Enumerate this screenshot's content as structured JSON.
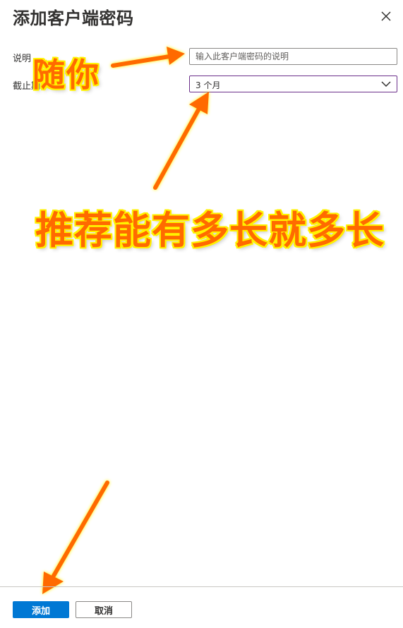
{
  "dialog": {
    "title": "添加客户端密码",
    "close_icon": "close-icon"
  },
  "form": {
    "description_label": "说明",
    "description_placeholder": "输入此客户端密码的说明",
    "description_value": "",
    "expiry_label": "截止期",
    "expiry_value": "3 个月",
    "expiry_icon": "chevron-down-icon"
  },
  "annotations": {
    "whatever": "随你",
    "recommend": "推荐能有多长就多长",
    "color": "#ff6a00",
    "outline_color": "#fff200"
  },
  "footer": {
    "add_label": "添加",
    "cancel_label": "取消"
  },
  "colors": {
    "primary": "#0078d4",
    "select_border": "#6b2f8a"
  }
}
